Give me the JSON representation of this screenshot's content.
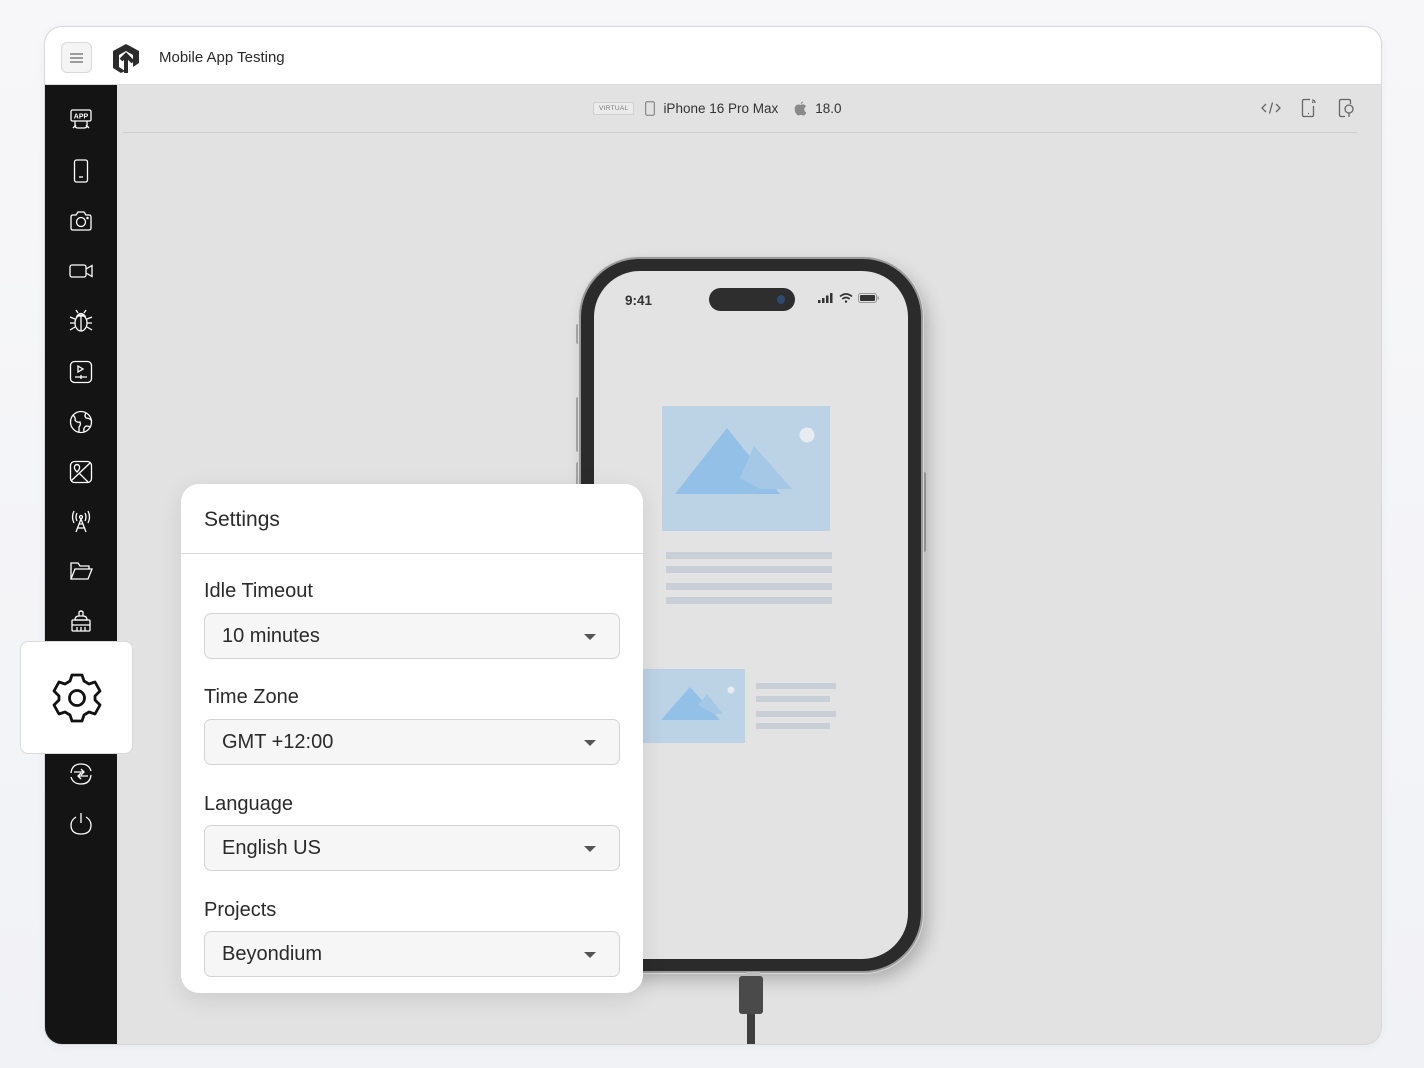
{
  "header": {
    "menu_icon": "hamburger-icon",
    "logo": "lambdatest-logo",
    "title": "Mobile App Testing"
  },
  "sidebar": {
    "items": [
      {
        "name": "app",
        "icon": "app-icon"
      },
      {
        "name": "device",
        "icon": "phone-icon"
      },
      {
        "name": "screenshot",
        "icon": "camera-icon"
      },
      {
        "name": "recording",
        "icon": "video-icon"
      },
      {
        "name": "debug",
        "icon": "bug-icon"
      },
      {
        "name": "test-runner",
        "icon": "play-screen-icon"
      },
      {
        "name": "geolocation",
        "icon": "globe-icon"
      },
      {
        "name": "image-injection",
        "icon": "image-location-icon"
      },
      {
        "name": "network",
        "icon": "antenna-icon"
      },
      {
        "name": "files",
        "icon": "folder-icon"
      },
      {
        "name": "clean",
        "icon": "brush-icon"
      },
      {
        "name": "settings",
        "icon": "gear-icon",
        "active": true
      },
      {
        "name": "switch-device",
        "icon": "switch-icon"
      },
      {
        "name": "end-session",
        "icon": "power-icon"
      }
    ]
  },
  "device_bar": {
    "badge": "VIRTUAL",
    "device_name": "iPhone 16 Pro Max",
    "os_version": "18.0",
    "tools": [
      "code-icon",
      "device-cast-icon",
      "device-inspect-icon"
    ]
  },
  "phone": {
    "time": "9:41"
  },
  "settings": {
    "title": "Settings",
    "fields": [
      {
        "label": "Idle Timeout",
        "value": "10 minutes"
      },
      {
        "label": "Time Zone",
        "value": "GMT +12:00"
      },
      {
        "label": "Language",
        "value": "English US"
      },
      {
        "label": "Projects",
        "value": "Beyondium"
      }
    ]
  },
  "colors": {
    "sidebar_bg": "#141414",
    "canvas_bg": "#e2e2e2",
    "placeholder_image": "#bcd3e6",
    "placeholder_mountain": "#93c0e6",
    "placeholder_line": "#c9cfd6"
  }
}
